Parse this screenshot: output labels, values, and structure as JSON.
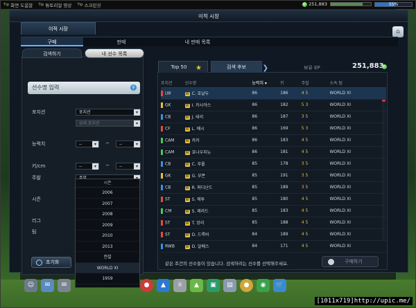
{
  "topbar": {
    "links": [
      {
        "tag": "Tip",
        "label": "화면 도움말"
      },
      {
        "tag": "Tip",
        "label": "튜토리얼 영상"
      },
      {
        "tag": "Tip",
        "label": "스크린샷"
      }
    ],
    "coins": "251,883",
    "percent": "55%"
  },
  "window": {
    "title": "이적 시장",
    "main_tab": "이적 시장",
    "subtabs": [
      "구매",
      "판매",
      "내 판매 목록"
    ]
  },
  "left": {
    "tabs": [
      "검색하기",
      "내 선수 목록"
    ],
    "search_placeholder": "선수명 입력",
    "position_label": "포지션",
    "position_value": "포지션",
    "sub_position": "상세 포지션",
    "ability_label": "능력치",
    "height_label": "키/cm",
    "foot_label": "주발",
    "foot_value": "주발",
    "season_label": "시즌",
    "league_label": "리그",
    "team_label": "팀",
    "dash": "~",
    "dash_value": "--",
    "reset": "초기화",
    "dropdown": {
      "head": "시즌",
      "items": [
        "2006",
        "2007",
        "2008",
        "2009",
        "2010",
        "2013",
        "전설",
        "WORLD XI",
        "1959"
      ]
    }
  },
  "right": {
    "tabs": [
      "Top 50",
      "검색 후보"
    ],
    "ep_label": "보유 EP",
    "ep_value": "251,883",
    "columns": [
      "포지션",
      "선수명",
      "능력치",
      "키",
      "주발",
      "소속 팀"
    ],
    "rows": [
      {
        "pos": "LW",
        "color": "#e84a3a",
        "name": "C. 호날두",
        "ovr": "86",
        "height": "186",
        "foot": "4 5",
        "team": "WORLD XI"
      },
      {
        "pos": "GK",
        "color": "#e8c13a",
        "name": "I. 카시야스",
        "ovr": "86",
        "height": "182",
        "foot": "5 3",
        "team": "WORLD XI"
      },
      {
        "pos": "CB",
        "color": "#3a8fe8",
        "name": "J. 테리",
        "ovr": "86",
        "height": "187",
        "foot": "3 5",
        "team": "WORLD XI"
      },
      {
        "pos": "CF",
        "color": "#e84a3a",
        "name": "L. 메시",
        "ovr": "86",
        "height": "169",
        "foot": "5 3",
        "team": "WORLD XI"
      },
      {
        "pos": "CAM",
        "color": "#4ac85a",
        "name": "카카",
        "ovr": "86",
        "height": "183",
        "foot": "4 5",
        "team": "WORLD XI"
      },
      {
        "pos": "CAM",
        "color": "#4ac85a",
        "name": "호나우지뉴",
        "ovr": "86",
        "height": "181",
        "foot": "4 5",
        "team": "WORLD XI"
      },
      {
        "pos": "CB",
        "color": "#3a8fe8",
        "name": "C. 푸욜",
        "ovr": "85",
        "height": "178",
        "foot": "3 5",
        "team": "WORLD XI"
      },
      {
        "pos": "GK",
        "color": "#e8c13a",
        "name": "G. 부폰",
        "ovr": "85",
        "height": "191",
        "foot": "3 5",
        "team": "WORLD XI"
      },
      {
        "pos": "CB",
        "color": "#3a8fe8",
        "name": "R. 퍼디난드",
        "ovr": "85",
        "height": "189",
        "foot": "3 5",
        "team": "WORLD XI"
      },
      {
        "pos": "ST",
        "color": "#e84a3a",
        "name": "S. 에투",
        "ovr": "85",
        "height": "180",
        "foot": "4 5",
        "team": "WORLD XI"
      },
      {
        "pos": "CM",
        "color": "#4ac85a",
        "name": "S. 제라드",
        "ovr": "85",
        "height": "183",
        "foot": "4 5",
        "team": "WORLD XI"
      },
      {
        "pos": "ST",
        "color": "#e84a3a",
        "name": "T. 앙리",
        "ovr": "85",
        "height": "188",
        "foot": "4 5",
        "team": "WORLD XI"
      },
      {
        "pos": "ST",
        "color": "#e84a3a",
        "name": "D. 드록바",
        "ovr": "84",
        "height": "189",
        "foot": "4 5",
        "team": "WORLD XI"
      },
      {
        "pos": "RWB",
        "color": "#3a8fe8",
        "name": "D. 알베스",
        "ovr": "84",
        "height": "171",
        "foot": "4 5",
        "team": "WORLD XI"
      }
    ],
    "note": "같은 조건의 선수들이 있습니다. 검색하려는 선수를 선택해주세요.",
    "buy": "구매하기"
  },
  "watermark": "[1011x719]http://upic.me/"
}
